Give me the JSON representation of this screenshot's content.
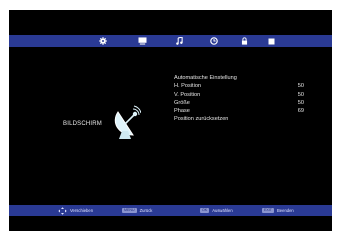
{
  "tabs": [
    {
      "name": "gear",
      "active": true
    },
    {
      "name": "monitor",
      "active": false
    },
    {
      "name": "music-note",
      "active": false
    },
    {
      "name": "clock",
      "active": false
    },
    {
      "name": "lock",
      "active": false
    },
    {
      "name": "square",
      "active": false
    }
  ],
  "section_label": "BILDSCHIRM",
  "menu": {
    "items": [
      {
        "label": "Automatische Einstellung",
        "value": ""
      },
      {
        "label": "H. Position",
        "value": "50"
      },
      {
        "label": "V. Position",
        "value": "50"
      },
      {
        "label": "Größe",
        "value": "50"
      },
      {
        "label": "Phase",
        "value": "69"
      },
      {
        "label": "Position zurücksetzen",
        "value": ""
      }
    ]
  },
  "hints": {
    "move_label": "Verschieben",
    "back_key": "MENU",
    "back_label": "Zurück",
    "select_key": "OK",
    "select_label": "Auswählen",
    "exit_key": "EXIT",
    "exit_label": "Beenden"
  },
  "colors": {
    "bar": "#2a3a94",
    "background": "#000000"
  }
}
